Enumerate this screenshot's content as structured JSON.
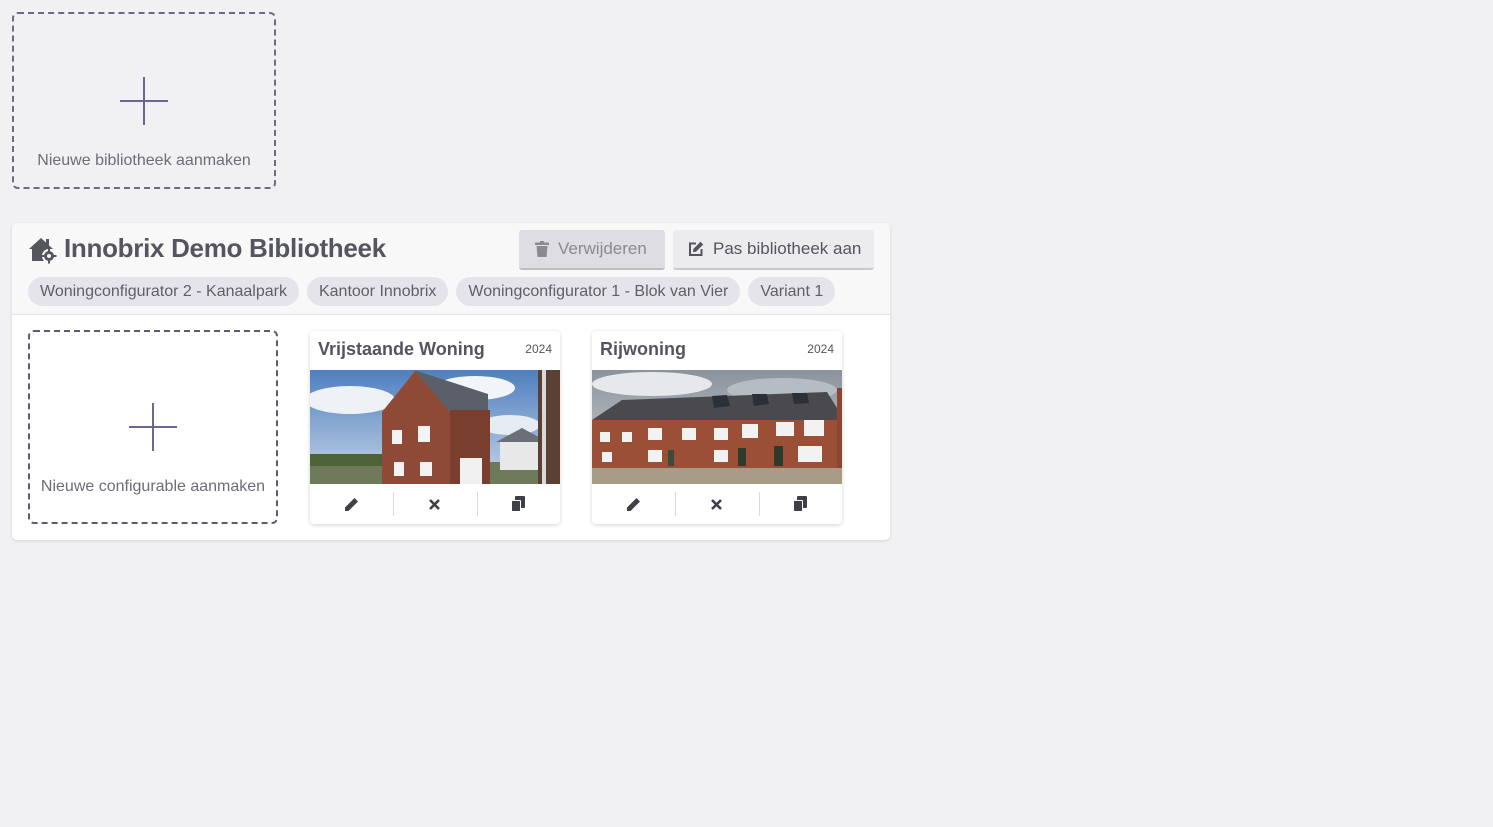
{
  "new_library": {
    "label": "Nieuwe bibliotheek aanmaken",
    "icon": "plus-icon"
  },
  "library": {
    "icon": "house-gear-icon",
    "title": "Innobrix Demo Bibliotheek",
    "delete_label": "Verwijderen",
    "delete_icon": "trash-icon",
    "edit_label": "Pas bibliotheek aan",
    "edit_icon": "edit-icon",
    "tags": [
      "Woningconfigurator 2 - Kanaalpark",
      "Kantoor Innobrix",
      "Woningconfigurator 1 - Blok van Vier",
      "Variant 1"
    ],
    "new_configurable": {
      "label": "Nieuwe configurable aanmaken",
      "icon": "plus-icon"
    },
    "configurables": [
      {
        "title": "Vrijstaande Woning",
        "year": "2024",
        "actions": [
          "pencil-icon",
          "close-icon",
          "copy-icon"
        ]
      },
      {
        "title": "Rijwoning",
        "year": "2024",
        "actions": [
          "pencil-icon",
          "close-icon",
          "copy-icon"
        ]
      }
    ]
  },
  "colors": {
    "background": "#f1f1f3",
    "dashed_border": "#6e6a80",
    "plus": "#6e6690",
    "tag_bg": "#e5e4ea",
    "text": "#55555f"
  }
}
